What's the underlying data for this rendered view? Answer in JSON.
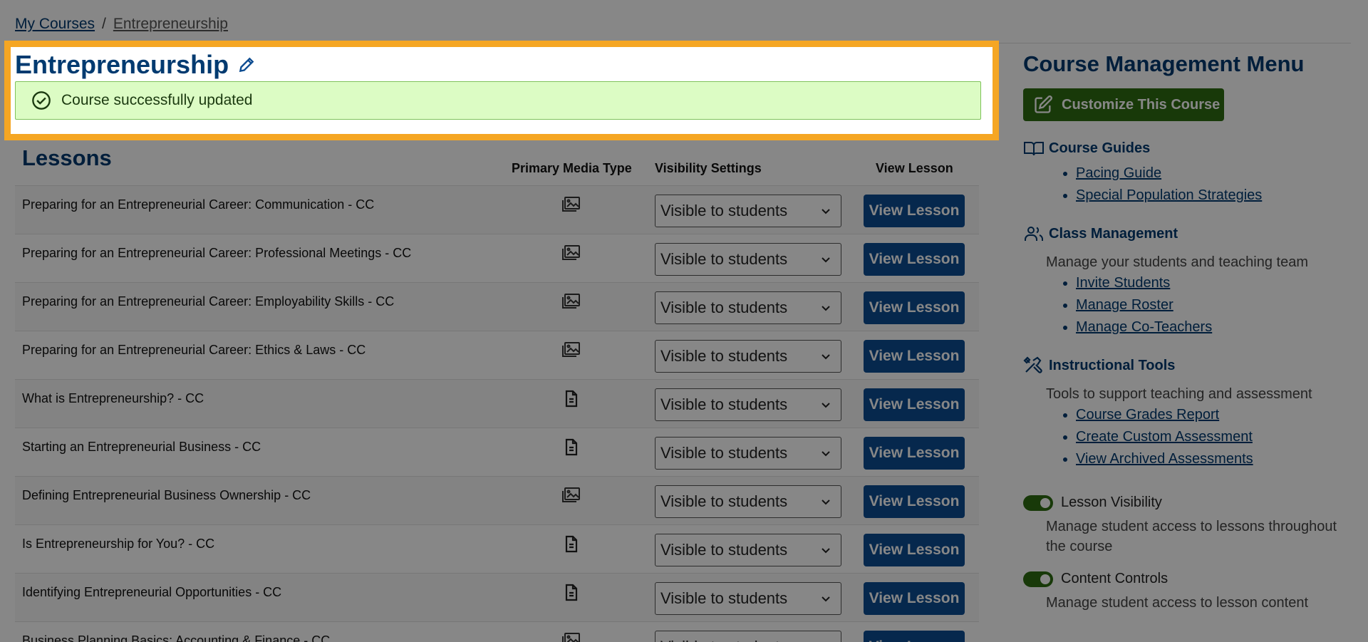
{
  "breadcrumb": {
    "root": "My Courses",
    "separator": "/",
    "current": "Entrepreneurship"
  },
  "page_title": "Entrepreneurship",
  "alert": {
    "message": "Course successfully updated"
  },
  "lessons": {
    "title": "Lessons",
    "columns": {
      "media": "Primary Media Type",
      "visibility": "Visibility Settings",
      "view": "View Lesson"
    },
    "rows": [
      {
        "name": "Preparing for an Entrepreneurial Career: Communication - CC",
        "media_icon": "slides-icon",
        "visibility": "Visible to students",
        "button": "View Lesson"
      },
      {
        "name": "Preparing for an Entrepreneurial Career: Professional Meetings - CC",
        "media_icon": "slides-icon",
        "visibility": "Visible to students",
        "button": "View Lesson"
      },
      {
        "name": "Preparing for an Entrepreneurial Career: Employability Skills - CC",
        "media_icon": "slides-icon",
        "visibility": "Visible to students",
        "button": "View Lesson"
      },
      {
        "name": "Preparing for an Entrepreneurial Career: Ethics & Laws - CC",
        "media_icon": "slides-icon",
        "visibility": "Visible to students",
        "button": "View Lesson"
      },
      {
        "name": "What is Entrepreneurship? - CC",
        "media_icon": "document-icon",
        "visibility": "Visible to students",
        "button": "View Lesson"
      },
      {
        "name": "Starting an Entrepreneurial Business - CC",
        "media_icon": "document-icon",
        "visibility": "Visible to students",
        "button": "View Lesson"
      },
      {
        "name": "Defining Entrepreneurial Business Ownership - CC",
        "media_icon": "slides-icon",
        "visibility": "Visible to students",
        "button": "View Lesson"
      },
      {
        "name": "Is Entrepreneurship for You? - CC",
        "media_icon": "document-icon",
        "visibility": "Visible to students",
        "button": "View Lesson"
      },
      {
        "name": "Identifying Entrepreneurial Opportunities - CC",
        "media_icon": "document-icon",
        "visibility": "Visible to students",
        "button": "View Lesson"
      },
      {
        "name": "Business Planning Basics: Accounting & Finance - CC",
        "media_icon": "slides-icon",
        "visibility": "Visible to students",
        "button": "View Lesson"
      }
    ]
  },
  "sidebar": {
    "title": "Course Management Menu",
    "customize_button": "Customize This Course",
    "course_guides": {
      "heading": "Course Guides",
      "links": [
        "Pacing Guide",
        "Special Population Strategies"
      ]
    },
    "class_management": {
      "heading": "Class Management",
      "description": "Manage your students and teaching team",
      "links": [
        "Invite Students",
        "Manage Roster",
        "Manage Co-Teachers"
      ]
    },
    "instructional_tools": {
      "heading": "Instructional Tools",
      "description": "Tools to support teaching and assessment",
      "links": [
        "Course Grades Report",
        "Create Custom Assessment",
        "View Archived Assessments"
      ]
    },
    "lesson_visibility": {
      "label": "Lesson Visibility",
      "description": "Manage student access to lessons throughout the course"
    },
    "content_controls": {
      "label": "Content Controls",
      "description": "Manage student access to lesson content"
    }
  },
  "colors": {
    "brand_blue": "#003a70",
    "button_blue": "#0d4c91",
    "accent_green": "#2e6d12",
    "highlight": "#f5a623",
    "alert_bg": "#dcfcc4"
  }
}
